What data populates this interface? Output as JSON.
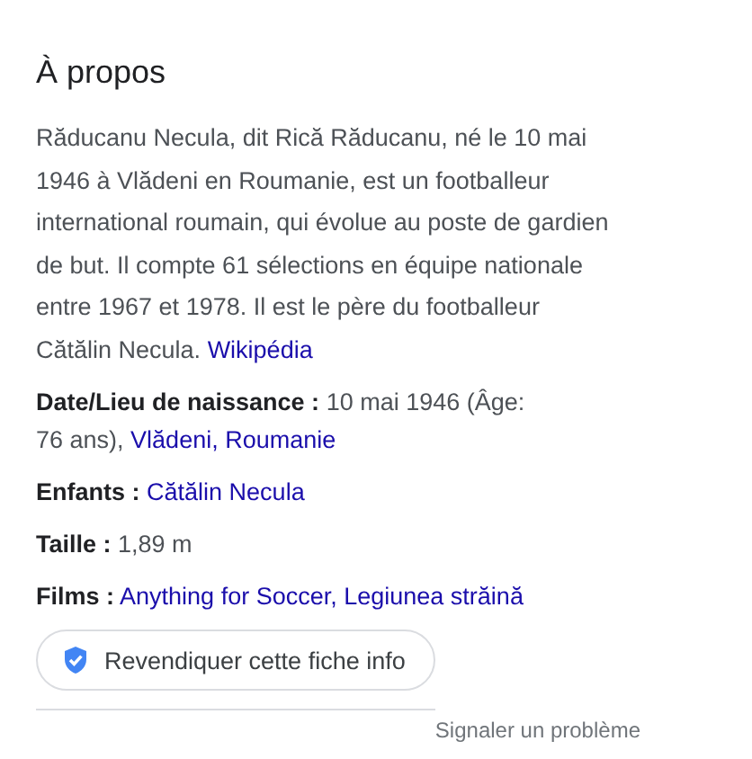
{
  "title": "À propos",
  "description": {
    "text": "Răducanu Necula, dit Rică Răducanu, né le 10 mai 1946 à Vlădeni en Roumanie, est un footballeur international roumain, qui évolue au poste de gardien de but. Il compte 61 sélections en équipe nationale entre 1967 et 1978. Il est le père du footballeur Cătălin Necula.",
    "source_link": "Wikipédia"
  },
  "facts": [
    {
      "label": "Date/Lieu de naissance :",
      "parts": [
        {
          "kind": "text",
          "text": "10 mai 1946 (Âge: 76 ans),"
        },
        {
          "kind": "link",
          "text": "Vlădeni,"
        },
        {
          "kind": "link",
          "text": "Roumanie"
        }
      ]
    },
    {
      "label": "Enfants :",
      "parts": [
        {
          "kind": "link",
          "text": "Cătălin Necula"
        }
      ]
    },
    {
      "label": "Taille :",
      "parts": [
        {
          "kind": "text",
          "text": "1,89 m"
        }
      ]
    },
    {
      "label": "Films :",
      "parts": [
        {
          "kind": "link",
          "text": "Anything for Soccer,"
        },
        {
          "kind": "link",
          "text": "Legiunea străină"
        }
      ]
    }
  ],
  "claim_button": "Revendiquer cette fiche info",
  "report_link": "Signaler un problème"
}
